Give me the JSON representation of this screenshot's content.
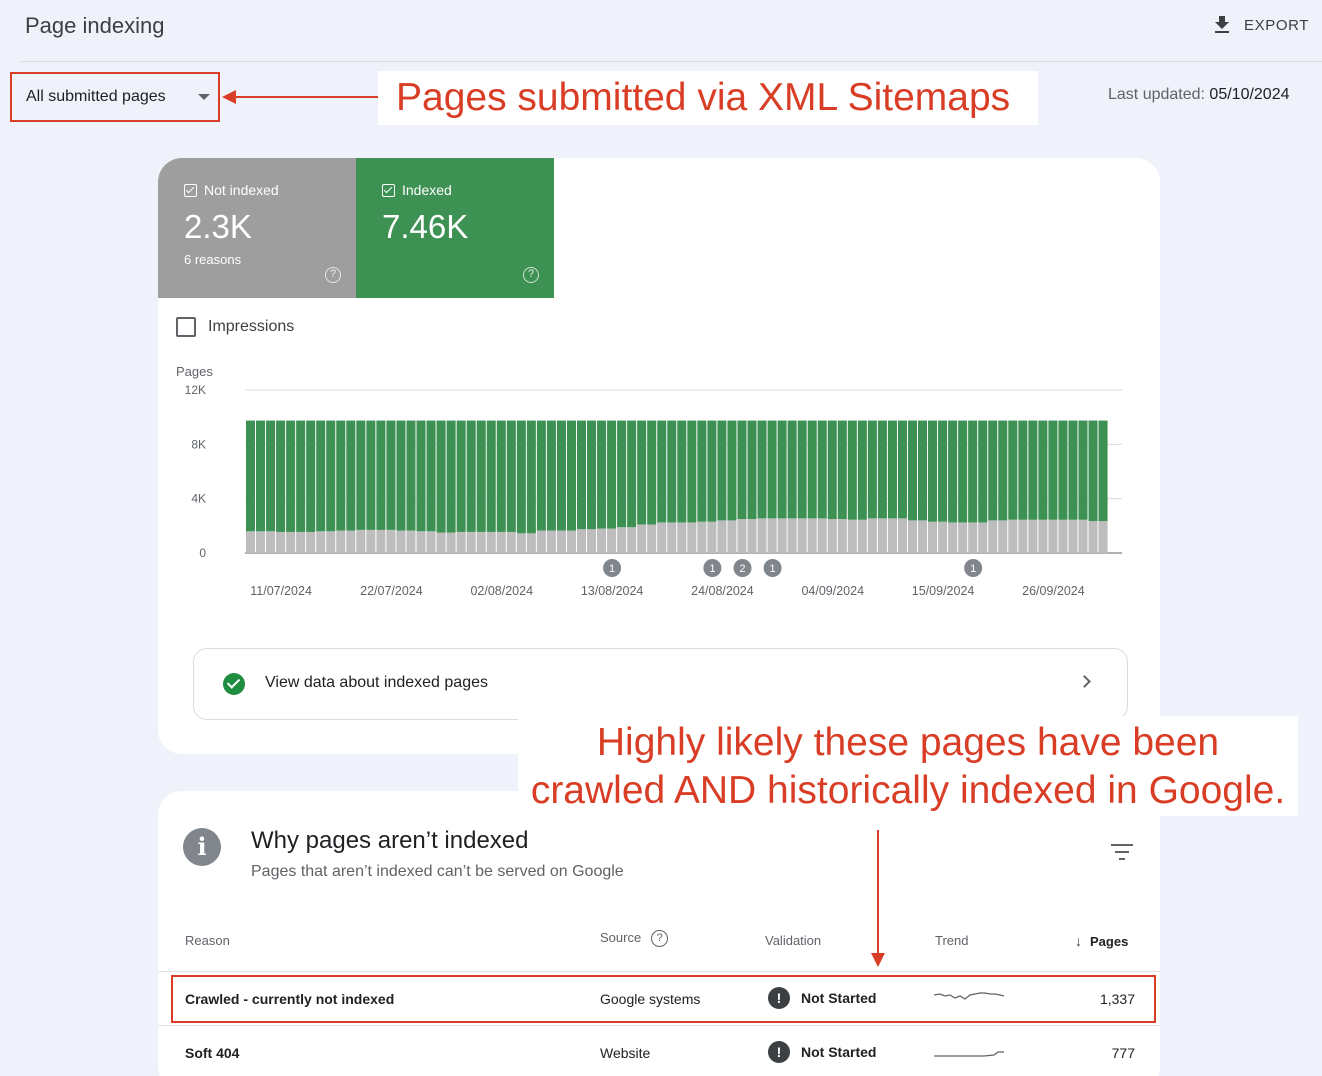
{
  "header": {
    "title": "Page indexing",
    "export_label": "EXPORT"
  },
  "filter": {
    "selected": "All submitted pages"
  },
  "annotations": {
    "sitemaps": "Pages submitted via XML Sitemaps",
    "likely_line1": "Highly likely these pages have been",
    "likely_line2": "crawled AND historically indexed in Google."
  },
  "last_updated": {
    "label": "Last updated:",
    "value": "05/10/2024"
  },
  "tiles": {
    "not_indexed": {
      "label": "Not indexed",
      "value": "2.3K",
      "sub": "6 reasons",
      "color": "#9e9e9e"
    },
    "indexed": {
      "label": "Indexed",
      "value": "7.46K",
      "color": "#3c9153"
    }
  },
  "impressions_label": "Impressions",
  "chart_data": {
    "type": "bar",
    "stacked": true,
    "ylabel": "Pages",
    "ylim": [
      0,
      12000
    ],
    "yticks": [
      "0",
      "4K",
      "8K",
      "12K"
    ],
    "ytick_values": [
      0,
      4000,
      8000,
      12000
    ],
    "x_tick_labels": [
      "11/07/2024",
      "22/07/2024",
      "02/08/2024",
      "13/08/2024",
      "24/08/2024",
      "04/09/2024",
      "15/09/2024",
      "26/09/2024"
    ],
    "x_tick_days": [
      3,
      14,
      25,
      36,
      47,
      58,
      69,
      80
    ],
    "days": 86,
    "series": [
      {
        "color": "#bdbdbd",
        "values": [
          1600,
          1600,
          1600,
          1550,
          1550,
          1550,
          1550,
          1600,
          1600,
          1650,
          1650,
          1700,
          1700,
          1700,
          1700,
          1650,
          1650,
          1600,
          1600,
          1500,
          1500,
          1550,
          1550,
          1550,
          1550,
          1550,
          1550,
          1450,
          1450,
          1650,
          1650,
          1650,
          1650,
          1750,
          1750,
          1800,
          1800,
          1900,
          1900,
          2100,
          2100,
          2250,
          2250,
          2250,
          2250,
          2300,
          2300,
          2400,
          2400,
          2500,
          2500,
          2550,
          2550,
          2550,
          2550,
          2550,
          2550,
          2550,
          2500,
          2500,
          2450,
          2450,
          2550,
          2550,
          2550,
          2550,
          2400,
          2400,
          2300,
          2300,
          2250,
          2250,
          2250,
          2250,
          2400,
          2400,
          2450,
          2450,
          2450,
          2450,
          2450,
          2450,
          2450,
          2450,
          2350,
          2350
        ]
      },
      {
        "color": "#3c9153",
        "values": [
          8150,
          8150,
          8150,
          8200,
          8200,
          8200,
          8200,
          8150,
          8150,
          8100,
          8100,
          8050,
          8050,
          8050,
          8050,
          8100,
          8100,
          8150,
          8150,
          8250,
          8250,
          8200,
          8200,
          8200,
          8200,
          8200,
          8200,
          8300,
          8300,
          8100,
          8100,
          8100,
          8100,
          8000,
          8000,
          7950,
          7950,
          7850,
          7850,
          7650,
          7650,
          7500,
          7500,
          7500,
          7500,
          7450,
          7450,
          7350,
          7350,
          7250,
          7250,
          7200,
          7200,
          7200,
          7200,
          7200,
          7200,
          7200,
          7250,
          7250,
          7300,
          7300,
          7200,
          7200,
          7200,
          7200,
          7350,
          7350,
          7450,
          7450,
          7500,
          7500,
          7500,
          7500,
          7350,
          7350,
          7300,
          7300,
          7300,
          7300,
          7300,
          7300,
          7300,
          7300,
          7400,
          7400
        ]
      }
    ],
    "markers": [
      {
        "day": 36,
        "label": "1"
      },
      {
        "day": 46,
        "label": "1"
      },
      {
        "day": 49,
        "label": "2"
      },
      {
        "day": 52,
        "label": "1"
      },
      {
        "day": 72,
        "label": "1"
      }
    ],
    "grid": true
  },
  "view_data_label": "View data about indexed pages",
  "why_section": {
    "title": "Why pages aren’t indexed",
    "subtitle": "Pages that aren’t indexed can’t be served on Google"
  },
  "table": {
    "headers": {
      "reason": "Reason",
      "source": "Source",
      "validation": "Validation",
      "trend": "Trend",
      "pages": "Pages"
    },
    "rows": [
      {
        "reason": "Crawled - currently not indexed",
        "source": "Google systems",
        "validation": "Not Started",
        "pages": "1,337"
      },
      {
        "reason": "Soft 404",
        "source": "Website",
        "validation": "Not Started",
        "pages": "777"
      }
    ]
  },
  "colors": {
    "annotation": "#d93d25",
    "indexed": "#3c9153",
    "not_indexed": "#bdbdbd"
  }
}
